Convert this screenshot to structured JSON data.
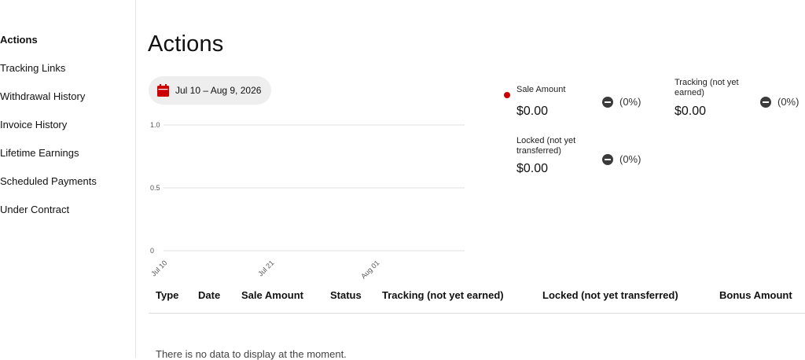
{
  "sidebar": {
    "items": [
      {
        "label": "Actions",
        "active": true
      },
      {
        "label": "Tracking Links"
      },
      {
        "label": "Withdrawal History"
      },
      {
        "label": "Invoice History"
      },
      {
        "label": "Lifetime Earnings"
      },
      {
        "label": "Scheduled Payments"
      },
      {
        "label": "Under Contract"
      }
    ]
  },
  "page": {
    "title": "Actions"
  },
  "date_range": {
    "label": "Jul 10 – Aug 9, 2026",
    "icon": "calendar-icon",
    "icon_color": "#cc0000"
  },
  "chart_data": {
    "type": "line",
    "x_ticks": [
      "Jul 10",
      "Jul 21",
      "Aug 01"
    ],
    "y_ticks": [
      "1.0",
      "0.5",
      "0"
    ],
    "ylim": [
      0,
      1
    ],
    "series": [],
    "grid": true
  },
  "metrics": {
    "sale_amount": {
      "label": "Sale Amount",
      "value": "$0.00",
      "change": "(0%)",
      "color": "#cc0000"
    },
    "tracking": {
      "label": "Tracking (not yet earned)",
      "value": "$0.00",
      "change": "(0%)"
    },
    "locked": {
      "label": "Locked (not yet transferred)",
      "value": "$0.00",
      "change": "(0%)"
    }
  },
  "table": {
    "columns": [
      "Type",
      "Date",
      "Sale Amount",
      "Status",
      "Tracking (not yet earned)",
      "Locked (not yet transferred)",
      "Bonus Amount"
    ],
    "empty_message": "There is no data to display at the moment."
  }
}
